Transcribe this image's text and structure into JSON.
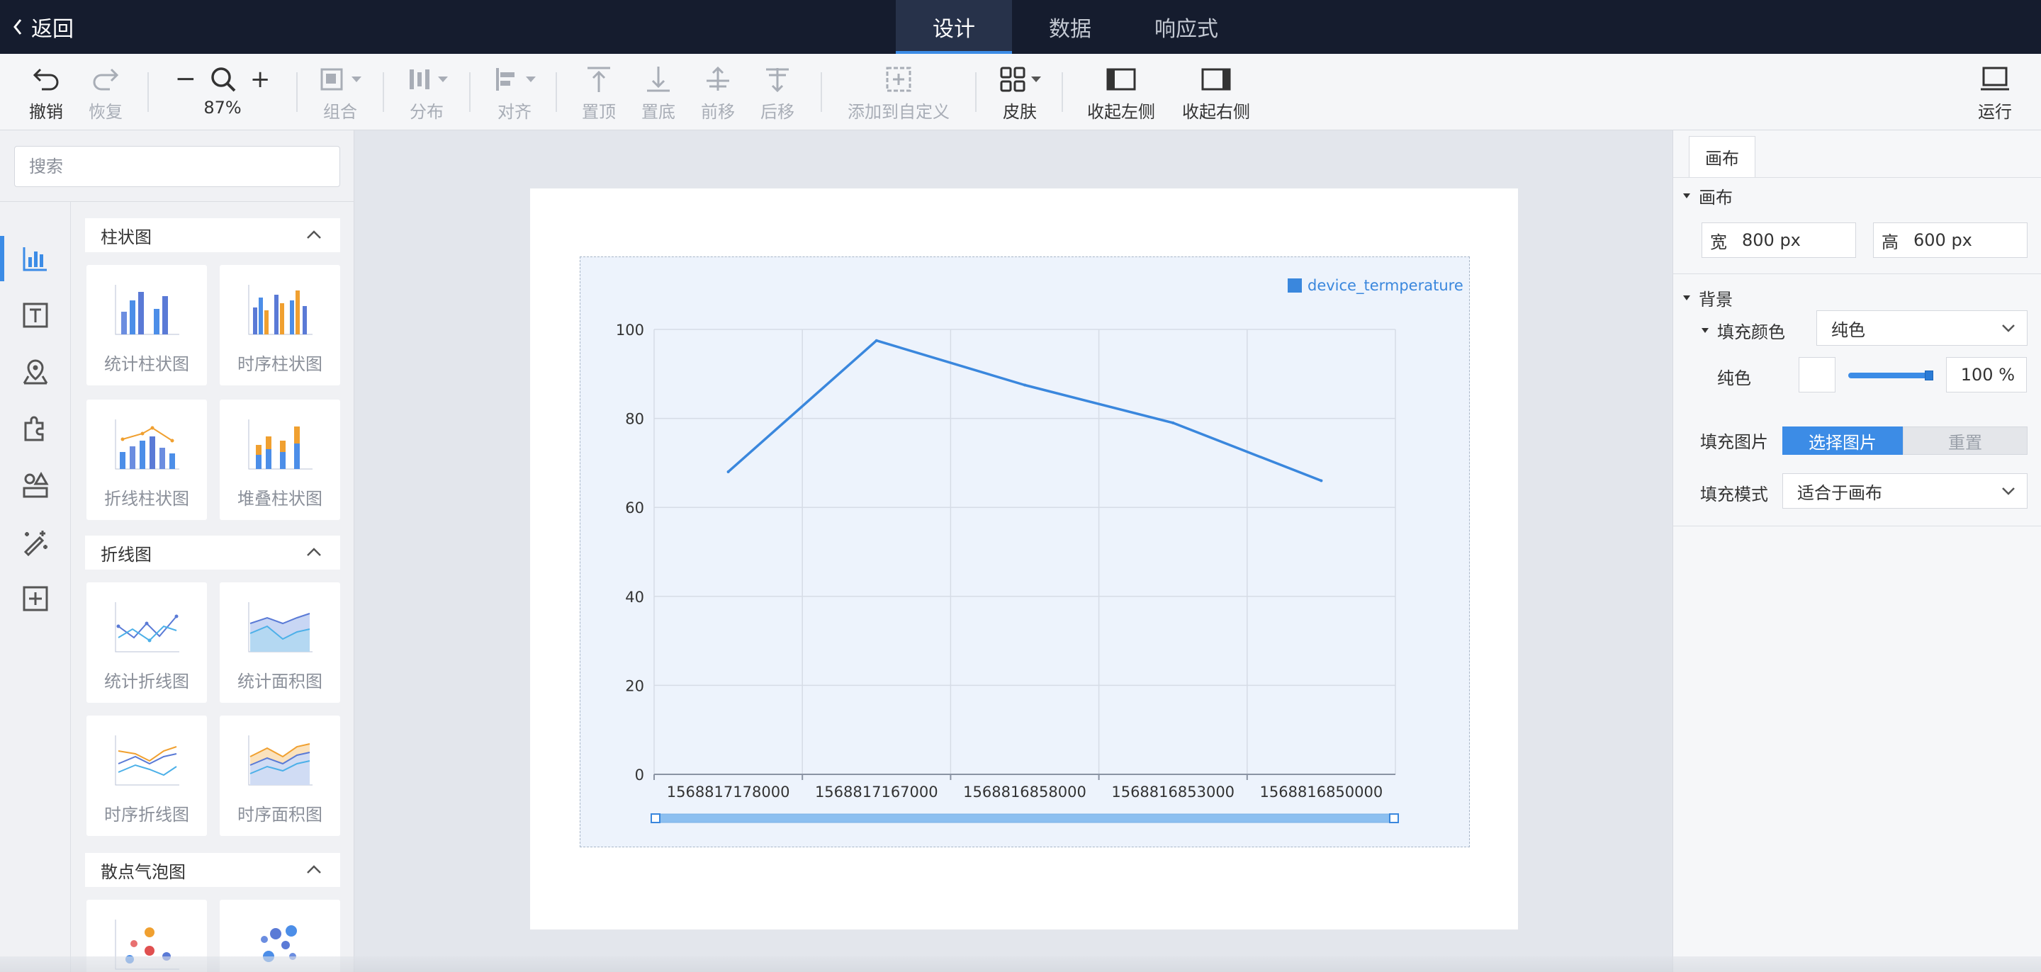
{
  "topnav": {
    "back_label": "返回",
    "tabs": [
      {
        "label": "设计",
        "active": true
      },
      {
        "label": "数据",
        "active": false
      },
      {
        "label": "响应式",
        "active": false
      }
    ]
  },
  "toolbar": {
    "undo": "撤销",
    "redo": "恢复",
    "zoom": "87%",
    "group": "组合",
    "distribute": "分布",
    "align": "对齐",
    "to_top": "置顶",
    "to_bottom": "置底",
    "forward": "前移",
    "backward": "后移",
    "add_custom": "添加到自定义",
    "skin": "皮肤",
    "collapse_left": "收起左侧",
    "collapse_right": "收起右侧",
    "run": "运行"
  },
  "left": {
    "search_placeholder": "搜索",
    "categories": [
      {
        "title": "柱状图",
        "items": [
          "统计柱状图",
          "时序柱状图",
          "折线柱状图",
          "堆叠柱状图"
        ]
      },
      {
        "title": "折线图",
        "items": [
          "统计折线图",
          "统计面积图",
          "时序折线图",
          "时序面积图"
        ]
      },
      {
        "title": "散点气泡图",
        "items": [
          "",
          ""
        ]
      }
    ]
  },
  "chart_data": {
    "type": "line",
    "categories": [
      "1568817178000",
      "1568817167000",
      "1568816858000",
      "1568816853000",
      "1568816850000"
    ],
    "series": [
      {
        "name": "device_termperature",
        "values": [
          68,
          97.5,
          87.5,
          79,
          66
        ]
      }
    ],
    "ylim": [
      0,
      100
    ],
    "yticks": [
      "0",
      "20",
      "40",
      "60",
      "80",
      "100"
    ],
    "grid": true,
    "legend": "top-right",
    "color": "#3a87dd",
    "has_data_zoom": true
  },
  "right": {
    "tab": "画布",
    "canvas_section": "画布",
    "width_label": "宽",
    "width_value": "800 px",
    "height_label": "高",
    "height_value": "600 px",
    "bg_section": "背景",
    "fill_color_label": "填充颜色",
    "fill_color_value": "纯色",
    "solid_label": "纯色",
    "opacity_value": "100 %",
    "fill_image_label": "填充图片",
    "choose_image": "选择图片",
    "reset": "重置",
    "fill_mode_label": "填充模式",
    "fill_mode_value": "适合于画布"
  },
  "colors": {
    "accent": "#3c8ce6",
    "nav_bg": "#151c2e"
  }
}
